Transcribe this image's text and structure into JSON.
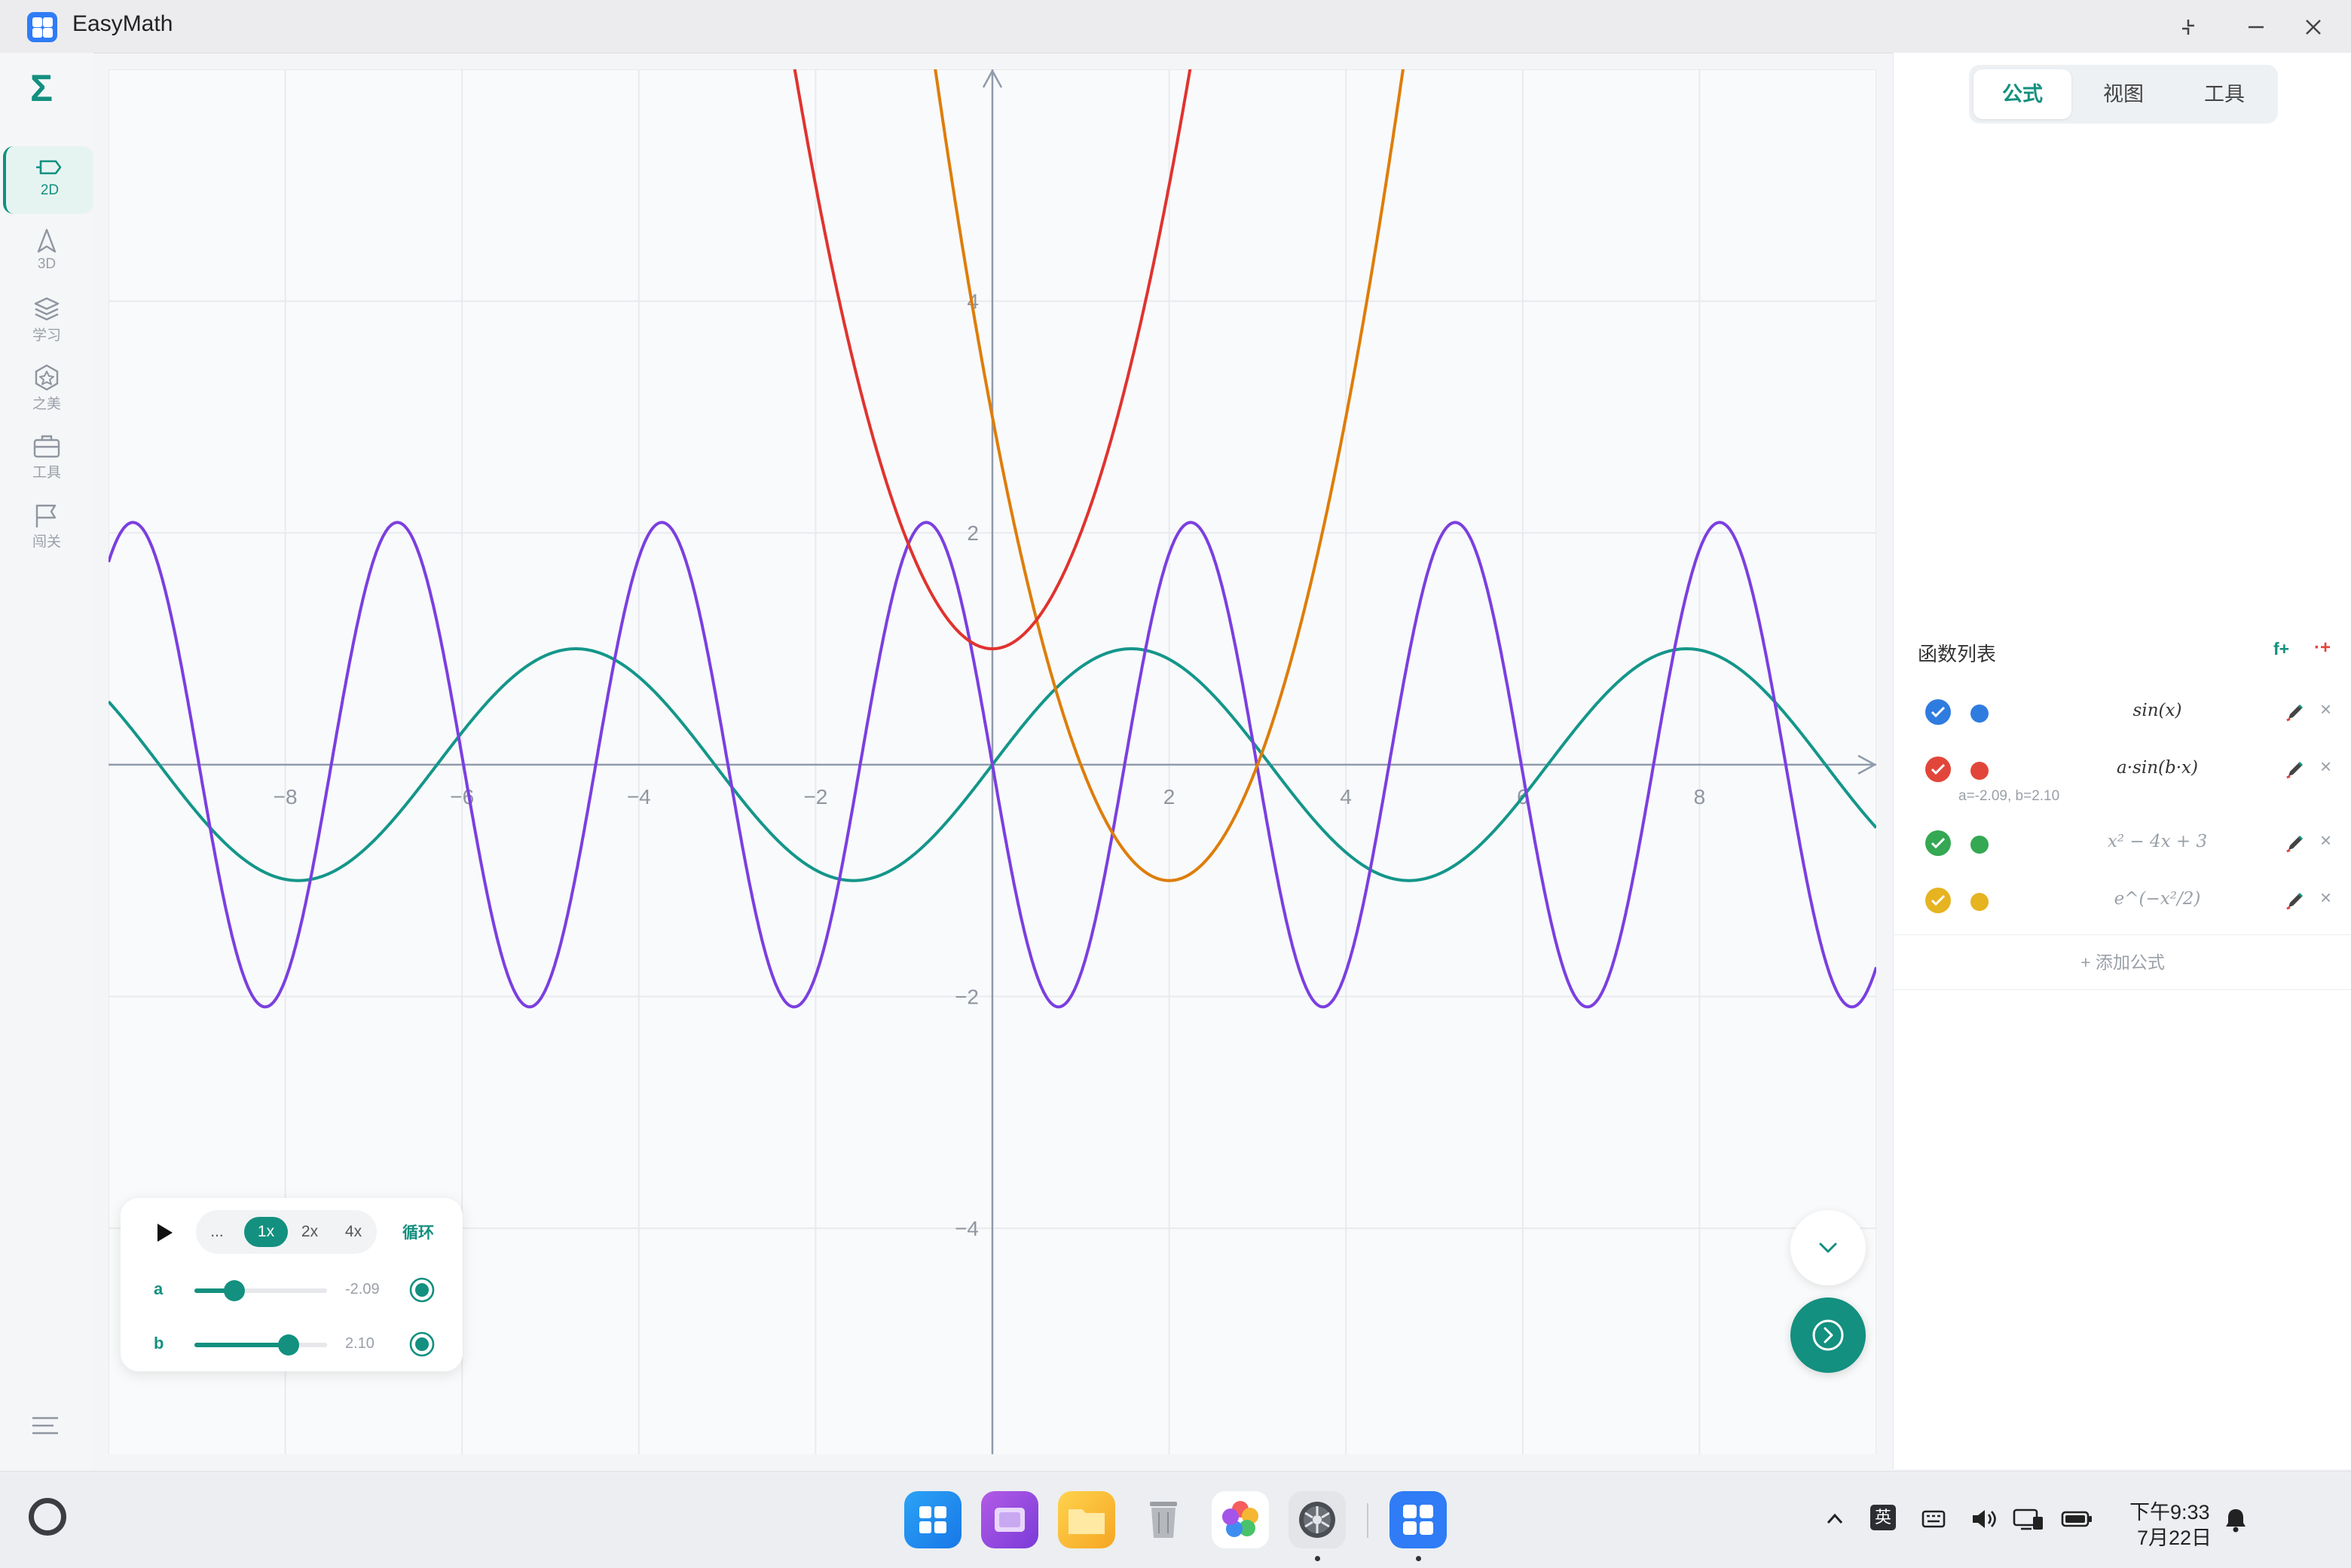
{
  "app": {
    "title": "EasyMath"
  },
  "sidebar": {
    "items": [
      {
        "label": "2D",
        "icon": "cube-2d-icon",
        "active": true
      },
      {
        "label": "3D",
        "icon": "navigation-icon"
      },
      {
        "label": "学习",
        "icon": "layers-icon"
      },
      {
        "label": "之美",
        "icon": "star-badge-icon"
      },
      {
        "label": "工具",
        "icon": "toolbox-icon"
      },
      {
        "label": "闯关",
        "icon": "flag-icon"
      }
    ]
  },
  "tabs": [
    {
      "label": "公式",
      "active": true
    },
    {
      "label": "视图"
    },
    {
      "label": "工具"
    }
  ],
  "functions": {
    "title": "函数列表",
    "add_function_label": "f+",
    "add_point_label": "·+",
    "add_formula_label": "+ 添加公式",
    "items": [
      {
        "formula": "sin(x)",
        "color": "#2f7ce0",
        "check_color": "#2f7ce0",
        "visible": true,
        "sub": ""
      },
      {
        "formula": "a·sin(b·x)",
        "color": "#e2463b",
        "check_color": "#e2463b",
        "visible": true,
        "sub": "a=-2.09, b=2.10"
      },
      {
        "formula": "x² − 4x + 3",
        "color": "#34a853",
        "check_color": "#34a853",
        "visible": true,
        "sub": ""
      },
      {
        "formula": "e^(−x²/2)",
        "color": "#e6b321",
        "check_color": "#e6b321",
        "visible": true,
        "sub": ""
      }
    ]
  },
  "animation": {
    "more_label": "...",
    "speeds": [
      "1x",
      "2x",
      "4x"
    ],
    "active_speed": "1x",
    "loop_label": "循环",
    "params": [
      {
        "name": "a",
        "value_text": "-2.09",
        "fraction": 0.3
      },
      {
        "name": "b",
        "value_text": "2.10",
        "fraction": 0.71
      }
    ]
  },
  "graph": {
    "x_ticks": [
      "-8",
      "-6",
      "-4",
      "-2",
      "2",
      "4",
      "6",
      "8"
    ],
    "y_ticks": [
      "4",
      "2",
      "-2",
      "-4"
    ],
    "xlim": [
      -10,
      10
    ],
    "ylim": [
      -5.95,
      6.0
    ],
    "curves": [
      {
        "expr": "sin(x)",
        "color": "#14968a"
      },
      {
        "expr": "-2.09·sin(2.10·x)",
        "color": "#7b3fe0"
      },
      {
        "expr": "x² − 4x + 3",
        "color": "#de7d0a"
      },
      {
        "expr": "x² + 1",
        "color": "#e0332f"
      }
    ]
  },
  "taskbar": {
    "apps": [
      "windows-app",
      "multitask-app",
      "files-app",
      "trash-app",
      "photos-app",
      "settings-app",
      "easymath-app"
    ],
    "tray": {
      "ime_label": "英",
      "time": "下午9:33",
      "date": "7月22日"
    }
  }
}
